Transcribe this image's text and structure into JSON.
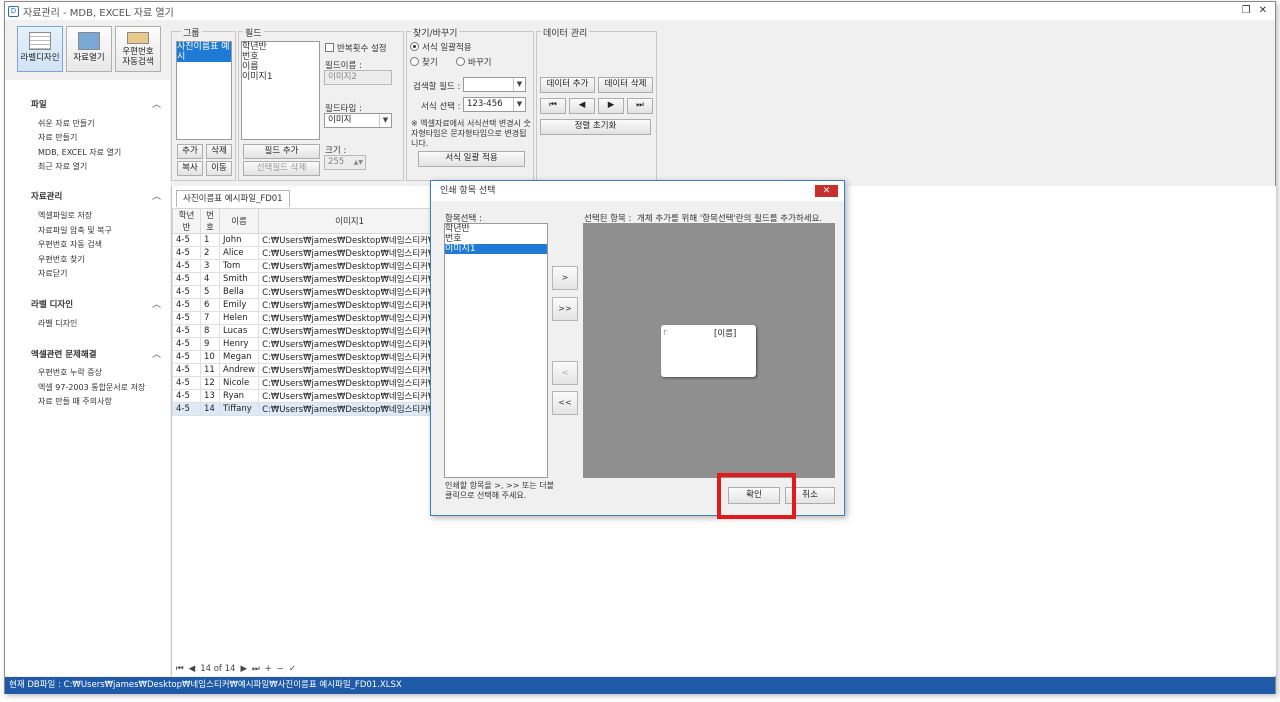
{
  "window": {
    "title": "자료관리 - MDB, EXCEL 자료 열기",
    "app_icon": "D"
  },
  "ribbon": {
    "big_buttons": [
      {
        "label": "라벨디자인",
        "icon": "label-design-icon"
      },
      {
        "label": "자료열기",
        "icon": "open-data-icon"
      },
      {
        "label": "우편번호\n자동검색",
        "icon": "postcode-search-icon"
      }
    ],
    "group": {
      "title": "그룹",
      "items": [
        "사진이름표 예시"
      ],
      "add": "추가",
      "delete": "삭제",
      "copy": "복사",
      "move": "이동"
    },
    "field": {
      "title": "필드",
      "items": [
        "학년반",
        "번호",
        "이름",
        "이미지1"
      ],
      "repeat_label": "반복횟수 설정",
      "name_label": "필드이름 :",
      "name_value": "이미지2",
      "type_label": "필드타입 :",
      "type_value": "이미지",
      "size_label": "크기 :",
      "size_value": "255",
      "add_field": "필드 추가",
      "delete_field": "선택필드 삭제"
    },
    "find": {
      "title": "찾기/바꾸기",
      "opt_bulk": "서식 일괄적용",
      "opt_find": "찾기",
      "opt_replace": "바꾸기",
      "search_field_label": "검색할 필드 :",
      "search_field_value": "",
      "format_label": "서식 선택 :",
      "format_value": "123-456",
      "note": "※ 엑셀자료에서 서식선택 변경시 숫자형타입은 문자형타입으로 변경됩니다.",
      "apply": "서식 일괄 적용"
    },
    "data_mgmt": {
      "title": "데이터 관리",
      "add": "데이터 추가",
      "delete": "데이터 삭제",
      "first": "⏮",
      "prev": "◀",
      "next": "▶",
      "last": "⏭",
      "reset_sort": "정렬 초기화"
    }
  },
  "sidebar": {
    "sections": [
      {
        "title": "파일",
        "items": [
          "쉬운 자료 만들기",
          "자료 만들기",
          "MDB, EXCEL 자료 열기",
          "최근 자료 열기"
        ]
      },
      {
        "title": "자료관리",
        "items": [
          "엑셀파일로 저장",
          "자료파일 압축 및 복구",
          "우편번호 자동 검색",
          "우편번호 찾기",
          "자료닫기"
        ]
      },
      {
        "title": "라벨 디자인",
        "items": [
          "라벨 디자인"
        ]
      },
      {
        "title": "엑셀관련 문제해결",
        "items": [
          "우편번호 누락 증상",
          "엑셀 97-2003 통합문서로 저장",
          "자료 만들 때 주의사항"
        ]
      }
    ]
  },
  "document": {
    "tab": "사진이름표 예시파일_FD01",
    "columns": [
      "학년반",
      "번호",
      "이름",
      "이미지1"
    ],
    "rows": [
      [
        "4-5",
        "1",
        "John",
        "C:₩Users₩james₩Desktop₩네임스티커₩예시파일₩"
      ],
      [
        "4-5",
        "2",
        "Alice",
        "C:₩Users₩james₩Desktop₩네임스티커₩예시파일₩"
      ],
      [
        "4-5",
        "3",
        "Tom",
        "C:₩Users₩james₩Desktop₩네임스티커₩예시파일₩"
      ],
      [
        "4-5",
        "4",
        "Smith",
        "C:₩Users₩james₩Desktop₩네임스티커₩예시파일₩"
      ],
      [
        "4-5",
        "5",
        "Bella",
        "C:₩Users₩james₩Desktop₩네임스티커₩예시파일₩"
      ],
      [
        "4-5",
        "6",
        "Emily",
        "C:₩Users₩james₩Desktop₩네임스티커₩예시파일₩"
      ],
      [
        "4-5",
        "7",
        "Helen",
        "C:₩Users₩james₩Desktop₩네임스티커₩예시파일₩"
      ],
      [
        "4-5",
        "8",
        "Lucas",
        "C:₩Users₩james₩Desktop₩네임스티커₩예시파일₩"
      ],
      [
        "4-5",
        "9",
        "Henry",
        "C:₩Users₩james₩Desktop₩네임스티커₩예시파일₩"
      ],
      [
        "4-5",
        "10",
        "Megan",
        "C:₩Users₩james₩Desktop₩네임스티커₩예시파일₩"
      ],
      [
        "4-5",
        "11",
        "Andrew",
        "C:₩Users₩james₩Desktop₩네임스티커₩예시파일₩"
      ],
      [
        "4-5",
        "12",
        "Nicole",
        "C:₩Users₩james₩Desktop₩네임스티커₩예시파일₩"
      ],
      [
        "4-5",
        "13",
        "Ryan",
        "C:₩Users₩james₩Desktop₩네임스티커₩예시파일₩"
      ],
      [
        "4-5",
        "14",
        "Tiffany",
        "C:₩Users₩james₩Desktop₩네임스티커₩예시파일₩"
      ]
    ],
    "navigator": {
      "first": "⏮",
      "prev": "◀",
      "position": "14 of 14",
      "next": "▶",
      "last": "⏭",
      "add": "+",
      "remove": "−",
      "confirm": "✓"
    }
  },
  "dialog": {
    "title": "인쇄 항목 선택",
    "close": "✕",
    "items_label": "항목선택 :",
    "items": [
      "학년반",
      "번호",
      "이미지1"
    ],
    "selected_index": 2,
    "selected_label": "선택된 항목 :",
    "hint": "개체 추가를 위해 '항목선택'란의 필드를 추가하세요.",
    "add_one": ">",
    "add_all": ">>",
    "remove_one": "<",
    "remove_all": "<<",
    "preview_field": "[이름]",
    "instruction": "인쇄할 항목을 >, >> 또는 더블 클릭으로 선택해 주세요.",
    "ok": "확인",
    "cancel": "취소"
  },
  "status": {
    "text": "현재 DB파일 : C:₩Users₩james₩Desktop₩네임스티커₩예시파일₩사진이름표 예시파일_FD01.XLSX"
  },
  "colors": {
    "accent": "#1e7ad4",
    "status_bg": "#1e5aa8",
    "highlight": "#e11b1b"
  }
}
